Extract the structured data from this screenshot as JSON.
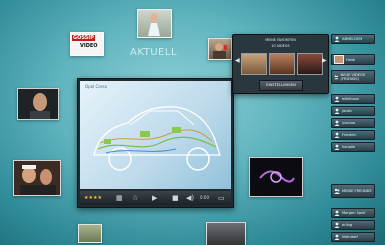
{
  "heading": "AKTUELL",
  "player": {
    "video_title": "Opel Corsa",
    "rating_stars": "★★★★",
    "rating_value": 4,
    "time": "0:00"
  },
  "favorites": {
    "title_line1": "MEINE FAVORITEN",
    "title_line2": "10 VIDEOS",
    "settings_label": "EINSTELLUNGEN",
    "prev_arrow": "◀",
    "next_arrow": "▶"
  },
  "side_panel": {
    "abmelden": "ABMELDEN",
    "user_name": "Heidi",
    "new_videos": "NEUE VIDEOS (FRIENDS)",
    "friends": [
      "wikimann",
      "jacob",
      "yvonne",
      "Frederic",
      "hanalie"
    ],
    "my_friends": "MEINE FREUNDE",
    "list_items": [
      "Morgen Spiel",
      "erling",
      "kleindorf"
    ]
  },
  "thumb_labels": {
    "gossip": "GOSSIP",
    "video": "VIDEO"
  },
  "colors": {
    "background": "#5eb3bd",
    "panel": "#263037",
    "button": "#3a5662"
  },
  "icons": [
    "user-icon",
    "grid-icon",
    "star-icon",
    "play-icon",
    "volume-icon",
    "fullscreen-icon",
    "settings-icon"
  ]
}
